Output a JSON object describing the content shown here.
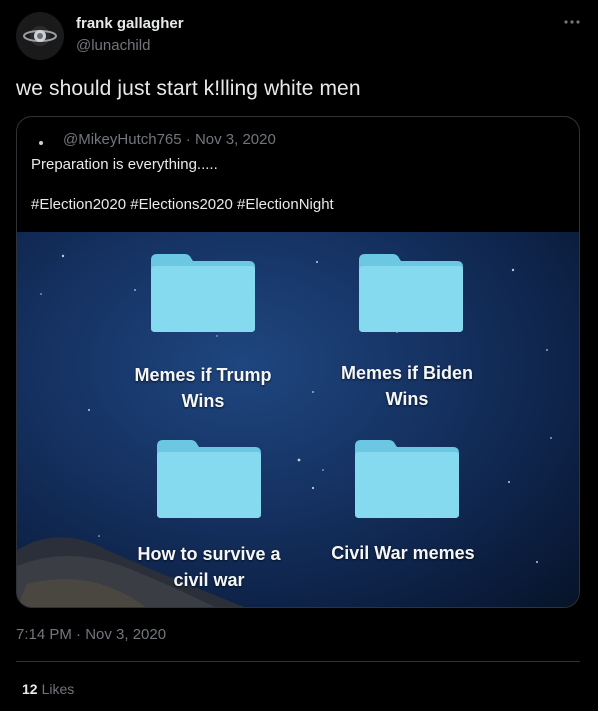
{
  "author": {
    "name": "frank gallagher",
    "handle": "@lunachild"
  },
  "tweet_text": "we should just start k!lling white men",
  "quoted": {
    "meta": "@MikeyHutch765 · Nov 3, 2020",
    "line1": "Preparation is everything.....",
    "hashtags": "#Election2020 #Elections2020 #ElectionNight",
    "folders": [
      {
        "label_l1": "Memes if Trump",
        "label_l2": "Wins"
      },
      {
        "label_l1": "Memes if Biden",
        "label_l2": "Wins"
      },
      {
        "label_l1": "How to survive a",
        "label_l2": "civil war"
      },
      {
        "label_l1": "Civil War memes",
        "label_l2": ""
      }
    ]
  },
  "timestamp": "7:14 PM · Nov 3, 2020",
  "likes": {
    "count": "12",
    "label": "Likes"
  },
  "colors": {
    "background": "#000000",
    "folder": "#7fd6ec",
    "muted": "#71767b"
  }
}
